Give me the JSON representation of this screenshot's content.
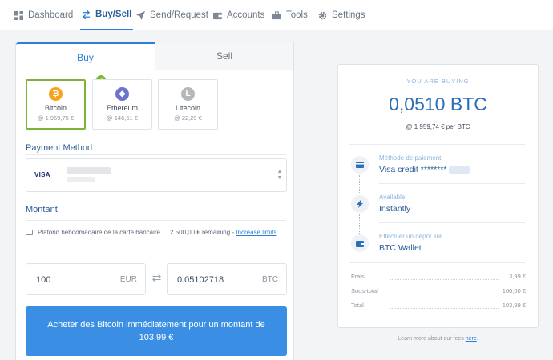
{
  "nav": {
    "items": [
      {
        "label": "Dashboard",
        "icon": "dashboard-icon",
        "active": false
      },
      {
        "label": "Buy/Sell",
        "icon": "buy-sell-icon",
        "active": true
      },
      {
        "label": "Send/Request",
        "icon": "send-icon",
        "active": false
      },
      {
        "label": "Accounts",
        "icon": "wallet-icon",
        "active": false
      },
      {
        "label": "Tools",
        "icon": "tools-icon",
        "active": false
      },
      {
        "label": "Settings",
        "icon": "gear-icon",
        "active": false
      }
    ]
  },
  "tabs": {
    "buy": "Buy",
    "sell": "Sell"
  },
  "coins": [
    {
      "name": "Bitcoin",
      "price": "@ 1 959,75 €",
      "symbol": "₿",
      "color": "#f7a21b",
      "selected": true
    },
    {
      "name": "Ethereum",
      "price": "@ 146,61 €",
      "symbol": "◆",
      "color": "#6b74c9",
      "selected": false
    },
    {
      "name": "Litecoin",
      "price": "@ 22,29 €",
      "symbol": "Ł",
      "color": "#b5b8bb",
      "selected": false
    }
  ],
  "payment": {
    "label": "Payment Method",
    "card_brand": "VISA"
  },
  "montant": {
    "label": "Montant",
    "limit_text": "Plafond hebdomadaire de la carte bancaire",
    "remaining": "2 500,00 € remaining -",
    "increase_link": "Increase limits",
    "fiat_value": "100",
    "fiat_currency": "EUR",
    "crypto_value": "0.05102718",
    "crypto_currency": "BTC"
  },
  "buy_button": "Acheter des Bitcoin immédiatement pour un montant de 103,99 €",
  "summary": {
    "heading": "YOU ARE BUYING",
    "amount": "0,0510 BTC",
    "rate": "@ 1 959,74 € per BTC",
    "steps": [
      {
        "label": "Méthode de paiement",
        "value": "Visa credit ********",
        "icon": "card-icon"
      },
      {
        "label": "Available",
        "value": "Instantly",
        "icon": "lightning-icon"
      },
      {
        "label": "Effectuer un dépôt sur",
        "value": "BTC Wallet",
        "icon": "wallet-icon"
      }
    ],
    "fees": [
      {
        "label": "Frais",
        "value": "3,99 €"
      },
      {
        "label": "Sous-total",
        "value": "100,00 €"
      },
      {
        "label": "Total",
        "value": "103,99 €"
      }
    ]
  },
  "footer": {
    "text": "Learn more about our fees",
    "link": "here",
    "suffix": "."
  },
  "colors": {
    "accent": "#2b7fd6",
    "button": "#3a8ee3",
    "check": "#7cbb2f"
  }
}
